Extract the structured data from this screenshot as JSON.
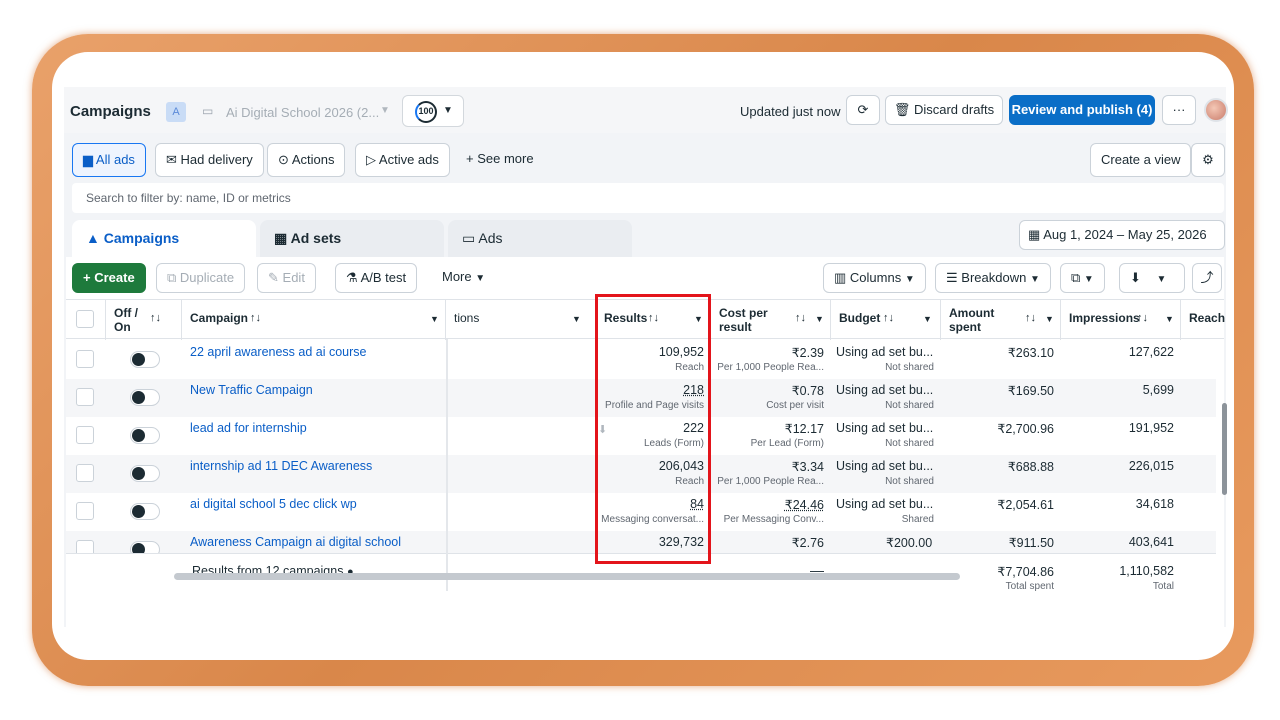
{
  "header": {
    "title": "Campaigns",
    "account_badge": "A",
    "account_name": "Ai Digital School 2026 (2...",
    "score": "100",
    "updated": "Updated just now",
    "discard_label": "Discard drafts",
    "publish_label": "Review and publish (4)",
    "more_label": "···"
  },
  "filters": {
    "all_ads": "All ads",
    "had_delivery": "Had delivery",
    "actions": "Actions",
    "active_ads": "Active ads",
    "see_more": "See more",
    "create_view": "Create a view",
    "search_placeholder": "Search to filter by: name, ID or metrics"
  },
  "tabs": {
    "campaigns": "Campaigns",
    "ad_sets": "Ad sets",
    "ads": "Ads",
    "date_range": "Aug 1, 2024 – May 25, 2026"
  },
  "toolbar": {
    "create": "Create",
    "duplicate": "Duplicate",
    "edit": "Edit",
    "ab_test": "A/B test",
    "more": "More",
    "columns": "Columns",
    "breakdown": "Breakdown"
  },
  "columns": {
    "off_on": "Off / On",
    "campaign": "Campaign",
    "actions_partial": "tions",
    "results": "Results",
    "cost_per_result_1": "Cost per",
    "cost_per_result_2": "result",
    "budget": "Budget",
    "amount_spent_1": "Amount",
    "amount_spent_2": "spent",
    "impressions": "Impressions",
    "reach": "Reach"
  },
  "rows": [
    {
      "name": "22 april awareness ad ai course",
      "results": "109,952",
      "results_sub": "Reach",
      "cost": "₹2.39",
      "cost_sub": "Per 1,000 People Rea...",
      "budget": "Using ad set bu...",
      "budget_sub": "Not shared",
      "spent": "₹263.10",
      "impressions": "127,622"
    },
    {
      "name": "New Traffic Campaign",
      "results": "218",
      "results_sub": "Profile and Page visits",
      "cost": "₹0.78",
      "cost_sub": "Cost per visit",
      "budget": "Using ad set bu...",
      "budget_sub": "Not shared",
      "spent": "₹169.50",
      "impressions": "5,699"
    },
    {
      "name": "lead ad for internship",
      "results": "222",
      "results_sub": "Leads (Form)",
      "cost": "₹12.17",
      "cost_sub": "Per Lead (Form)",
      "budget": "Using ad set bu...",
      "budget_sub": "Not shared",
      "spent": "₹2,700.96",
      "impressions": "191,952"
    },
    {
      "name": "internship ad 11 DEC Awareness",
      "results": "206,043",
      "results_sub": "Reach",
      "cost": "₹3.34",
      "cost_sub": "Per 1,000 People Rea...",
      "budget": "Using ad set bu...",
      "budget_sub": "Not shared",
      "spent": "₹688.88",
      "impressions": "226,015"
    },
    {
      "name": "ai digital school 5 dec click wp",
      "results": "84",
      "results_sub": "Messaging conversat...",
      "cost": "₹24.46",
      "cost_sub": "Per Messaging Conv...",
      "budget": "Using ad set bu...",
      "budget_sub": "Shared",
      "spent": "₹2,054.61",
      "impressions": "34,618"
    },
    {
      "name": "Awareness Campaign ai digital school",
      "results": "329,732",
      "results_sub": "",
      "cost": "₹2.76",
      "cost_sub": "",
      "budget": "₹200.00",
      "budget_sub": "",
      "spent": "₹911.50",
      "impressions": "403,641"
    }
  ],
  "footer": {
    "label": "Results from 12 campaigns",
    "cost_dash": "—",
    "spent": "₹7,704.86",
    "spent_sub": "Total spent",
    "impressions": "1,110,582",
    "impressions_sub": "Total"
  }
}
